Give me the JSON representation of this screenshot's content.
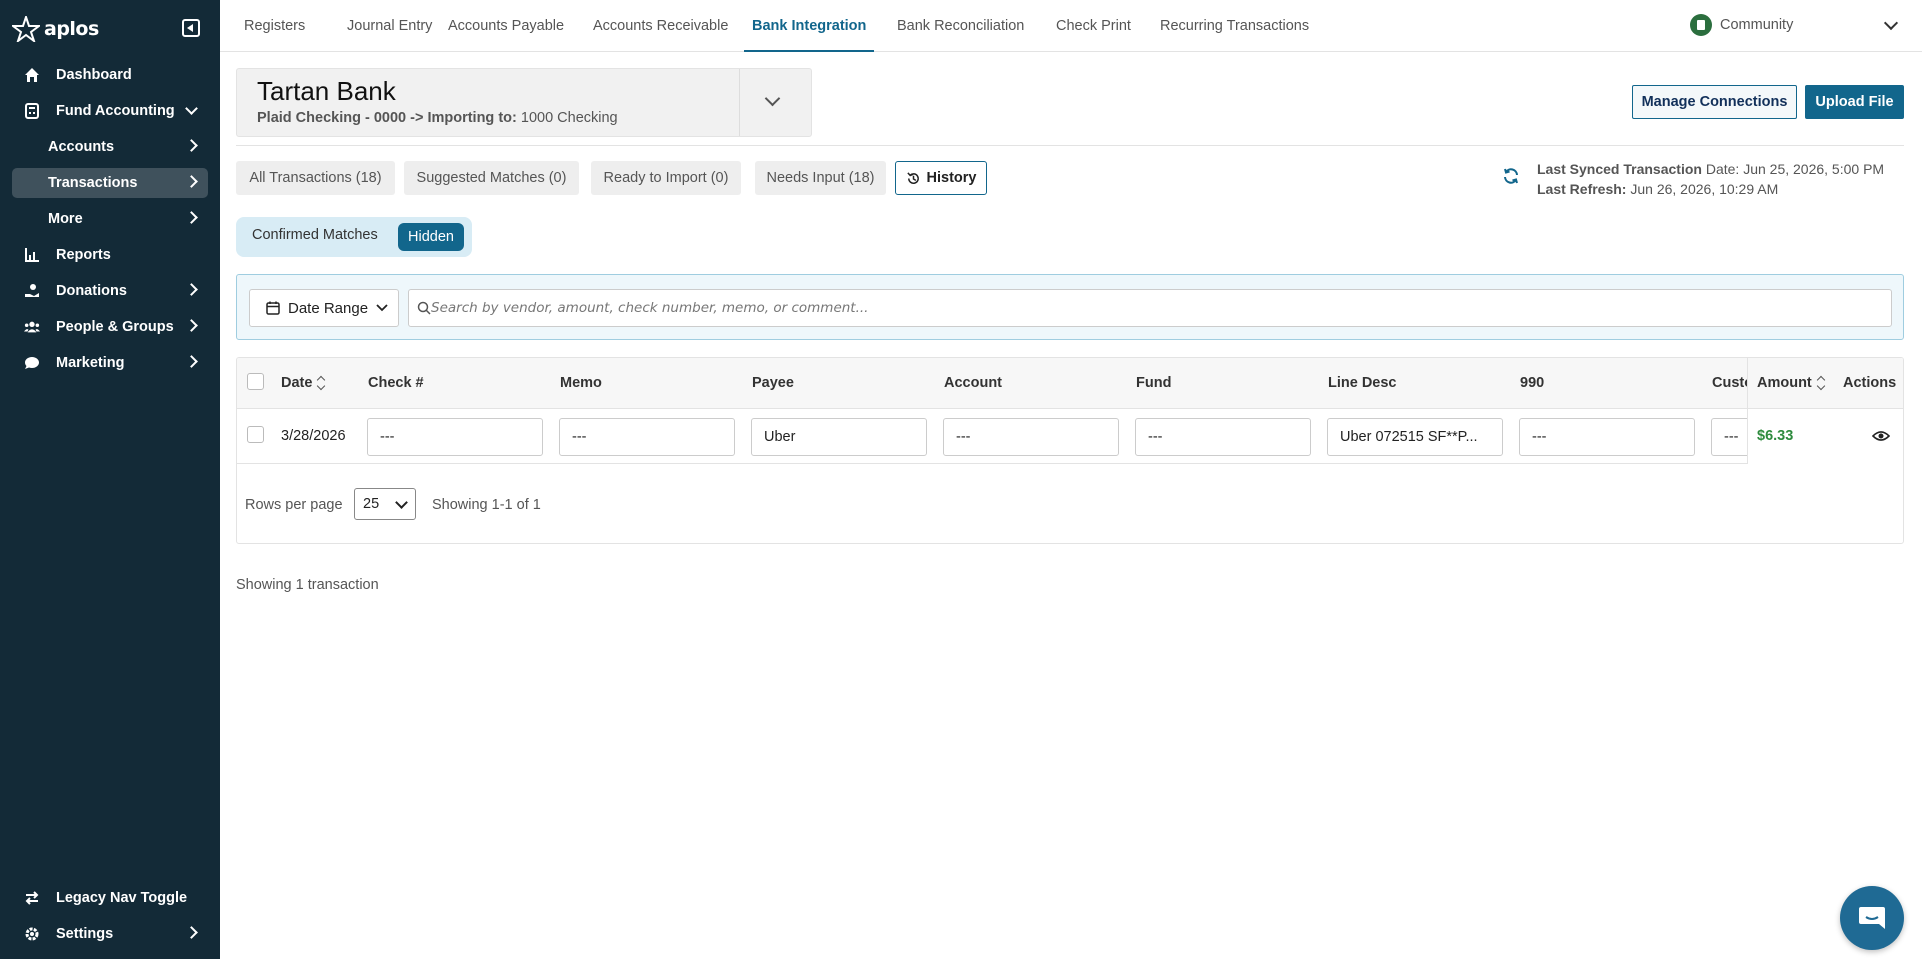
{
  "sidebar": {
    "logo_text": "aplos",
    "items": [
      {
        "label": "Dashboard",
        "icon": "home-icon"
      },
      {
        "label": "Fund Accounting",
        "icon": "calculator-icon"
      },
      {
        "label": "Accounts"
      },
      {
        "label": "Transactions"
      },
      {
        "label": "More"
      },
      {
        "label": "Reports",
        "icon": "chart-icon"
      },
      {
        "label": "Donations",
        "icon": "donation-icon"
      },
      {
        "label": "People & Groups",
        "icon": "people-icon"
      },
      {
        "label": "Marketing",
        "icon": "chat-bubble-icon"
      }
    ],
    "legacy_toggle": "Legacy Nav Toggle",
    "settings": "Settings"
  },
  "topnav": {
    "tabs": [
      "Registers",
      "Journal Entry",
      "Accounts Payable",
      "Accounts Receivable",
      "Bank Integration",
      "Bank Reconciliation",
      "Check Print",
      "Recurring Transactions"
    ],
    "active": "Bank Integration",
    "org": "Community"
  },
  "bank": {
    "name": "Tartan Bank",
    "source": "Plaid Checking - 0000 -> Importing to:",
    "target": "1000 Checking"
  },
  "actions": {
    "manage_connections": "Manage Connections",
    "upload_file": "Upload File"
  },
  "tabs": {
    "all": "All Transactions (18)",
    "suggested": "Suggested Matches (0)",
    "ready": "Ready to Import (0)",
    "needs_input": "Needs Input (18)",
    "history": "History"
  },
  "sync": {
    "synced_label": "Last Synced Transaction",
    "synced_value": "Date: Jun 25, 2026, 5:00 PM",
    "refresh_label": "Last Refresh:",
    "refresh_value": "Jun 26, 2026, 10:29 AM"
  },
  "toggle": {
    "confirmed": "Confirmed Matches",
    "hidden": "Hidden"
  },
  "filter": {
    "date_range": "Date Range",
    "search_placeholder": "Search by vendor, amount, check number, memo, or comment..."
  },
  "table": {
    "columns": [
      "Date",
      "Check #",
      "Memo",
      "Payee",
      "Account",
      "Fund",
      "Line Desc",
      "990",
      "Custo",
      "Amount",
      "Actions"
    ],
    "rows": [
      {
        "date": "3/28/2026",
        "check": "---",
        "memo": "---",
        "payee": "Uber",
        "account": "---",
        "fund": "---",
        "line_desc": "Uber 072515 SF**P...",
        "f990": "---",
        "custom": "---",
        "amount": "$6.33"
      }
    ],
    "rows_per_page_label": "Rows per page",
    "rows_per_page": "25",
    "showing": "Showing 1-1 of 1"
  },
  "footer_count": "Showing 1 transaction",
  "colors": {
    "sidebar_bg": "#132a37",
    "accent": "#12668c",
    "amount_positive": "#2e8b3e"
  }
}
